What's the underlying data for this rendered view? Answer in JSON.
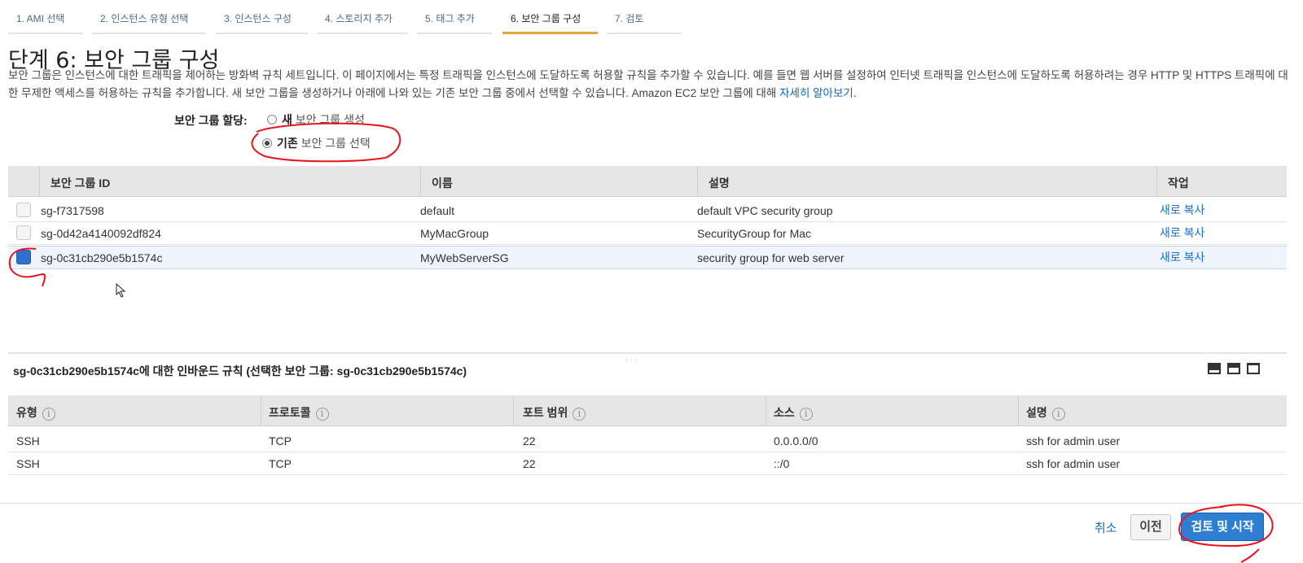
{
  "tabs": [
    "1. AMI 선택",
    "2. 인스턴스 유형 선택",
    "3. 인스턴스 구성",
    "4. 스토리지 추가",
    "5. 태그 추가",
    "6. 보안 그룹 구성",
    "7. 검토"
  ],
  "active_tab": "6. 보안 그룹 구성",
  "page_title": "단계 6: 보안 그룹 구성",
  "description": {
    "text": "보안 그룹은 인스턴스에 대한 트래픽을 제어하는 방화벽 규칙 세트입니다. 이 페이지에서는 특정 트래픽을 인스턴스에 도달하도록 허용할 규칙을 추가할 수 있습니다. 예를 들면 웹 서버를 설정하여 인터넷 트래픽을 인스턴스에 도달하도록 허용하려는 경우 HTTP 및 HTTPS 트래픽에 대한 무제한 액세스를 허용하는 규칙을 추가합니다. 새 보안 그룹을 생성하거나 아래에 나와 있는 기존 보안 그룹 중에서 선택할 수 있습니다. Amazon EC2 보안 그룹에 대해 ",
    "link": "자세히 알아보기",
    "end": "."
  },
  "assign": {
    "label": "보안 그룹 할당:",
    "option_new_bold": "새",
    "option_new_rest": " 보안 그룹 생성",
    "option_existing_bold": "기존",
    "option_existing_rest": " 보안 그룹 선택",
    "selected": "existing"
  },
  "sg_table": {
    "headers": {
      "id": "보안 그룹 ID",
      "name": "이름",
      "desc": "설명",
      "action": "작업"
    },
    "rows": [
      {
        "id": "sg-f7317598",
        "name": "default",
        "desc": "default VPC security group",
        "action": "새로 복사",
        "checked": false
      },
      {
        "id": "sg-0d42a4140092df824",
        "name": "MyMacGroup",
        "desc": "SecurityGroup for Mac",
        "action": "새로 복사",
        "checked": false
      },
      {
        "id": "sg-0c31cb290e5b1574c",
        "name": "MyWebServerSG",
        "desc": "security group for web server",
        "action": "새로 복사",
        "checked": true
      }
    ]
  },
  "rules": {
    "title": "sg-0c31cb290e5b1574c에 대한 인바운드 규칙 (선택한 보안 그룹: sg-0c31cb290e5b1574c)",
    "headers": {
      "type": "유형",
      "protocol": "프로토콜",
      "port": "포트 범위",
      "source": "소스",
      "desc": "설명"
    },
    "info_icon": "i",
    "rows": [
      {
        "type": "SSH",
        "protocol": "TCP",
        "port": "22",
        "source": "0.0.0.0/0",
        "desc": "ssh for admin user"
      },
      {
        "type": "SSH",
        "protocol": "TCP",
        "port": "22",
        "source": "::/0",
        "desc": "ssh for admin user"
      }
    ]
  },
  "buttons": {
    "cancel": "취소",
    "previous": "이전",
    "launch": "검토 및 시작"
  },
  "colors": {
    "accent_tab": "#e8a33d",
    "link": "#1a6fc7",
    "primary": "#2e7fd4",
    "annotation": "#e8141c"
  }
}
